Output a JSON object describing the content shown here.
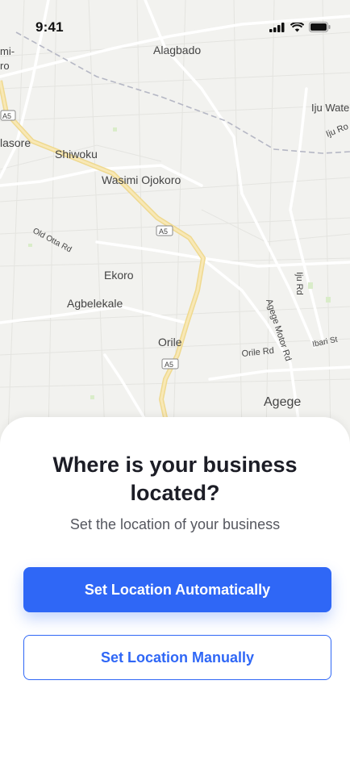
{
  "status_bar": {
    "time": "9:41"
  },
  "map": {
    "labels": {
      "alagbado": "Alagbado",
      "iju_water": "Iju Wate",
      "iju_ro": "Iju Ro",
      "alasore": "lasore",
      "mi": "mi-",
      "ro": "ro",
      "shiwoku": "Shiwoku",
      "wasimi": "Wasimi Ojokoro",
      "old_otta": "Old Otta Rd",
      "ekoro": "Ekoro",
      "agbelekale": "Agbelekale",
      "orile": "Orile",
      "orile_rd": "Orile Rd",
      "agege_motor": "Agege Motor Rd",
      "iju_rd": "Iju Rd",
      "ibari": "Ibari St",
      "agege": "Agege",
      "a5_1": "A5",
      "a5_2": "A5",
      "a5_3": "A5"
    }
  },
  "sheet": {
    "title_line1": "Where is your business",
    "title_line2": "located?",
    "subtitle": "Set the location of your business",
    "primary_button": "Set Location Automatically",
    "secondary_button": "Set Location Manually"
  },
  "colors": {
    "accent": "#2f67f6",
    "title": "#1c1d26",
    "subtitle": "#55575f",
    "map_background": "#f2f2ef",
    "highway": "#f3dfa0"
  }
}
